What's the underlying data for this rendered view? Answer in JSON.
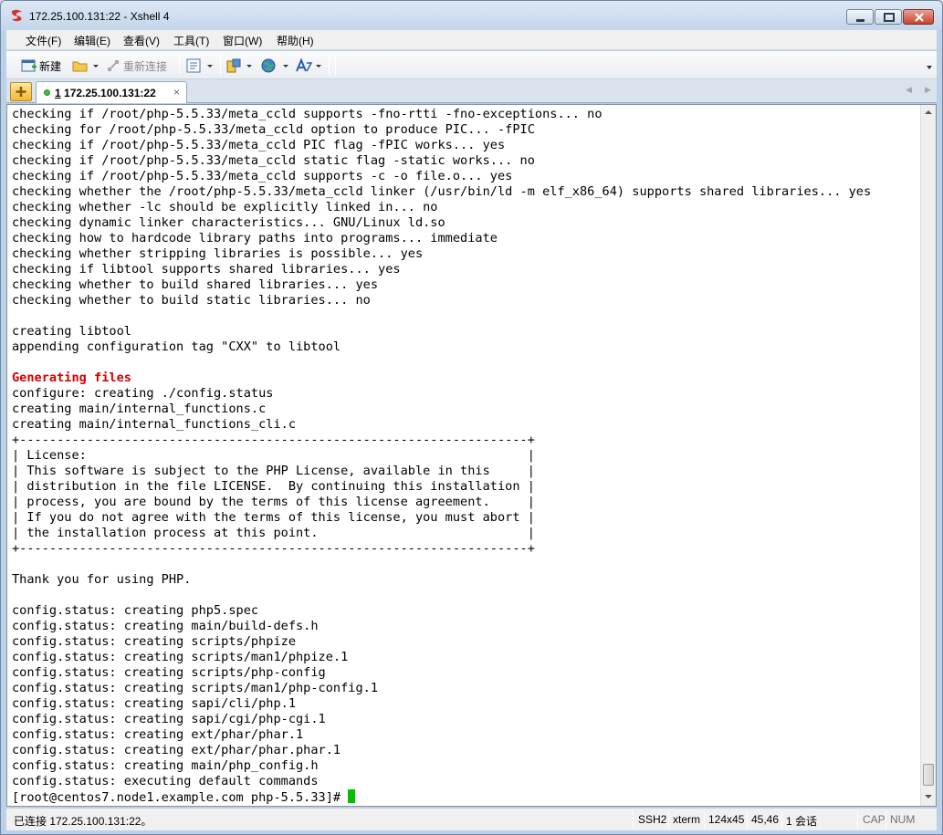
{
  "window": {
    "title": "172.25.100.131:22 - Xshell 4"
  },
  "menu": {
    "items": [
      "文件(F)",
      "编辑(E)",
      "查看(V)",
      "工具(T)",
      "窗口(W)",
      "帮助(H)"
    ]
  },
  "toolbar": {
    "new_label": "新建",
    "reconnect_label": "重新连接"
  },
  "tabs": [
    {
      "number": "1",
      "label": " 172.25.100.131:22",
      "close": "×"
    }
  ],
  "terminal": {
    "lines": [
      "checking if /root/php-5.5.33/meta_ccld supports -fno-rtti -fno-exceptions... no",
      "checking for /root/php-5.5.33/meta_ccld option to produce PIC... -fPIC",
      "checking if /root/php-5.5.33/meta_ccld PIC flag -fPIC works... yes",
      "checking if /root/php-5.5.33/meta_ccld static flag -static works... no",
      "checking if /root/php-5.5.33/meta_ccld supports -c -o file.o... yes",
      "checking whether the /root/php-5.5.33/meta_ccld linker (/usr/bin/ld -m elf_x86_64) supports shared libraries... yes",
      "checking whether -lc should be explicitly linked in... no",
      "checking dynamic linker characteristics... GNU/Linux ld.so",
      "checking how to hardcode library paths into programs... immediate",
      "checking whether stripping libraries is possible... yes",
      "checking if libtool supports shared libraries... yes",
      "checking whether to build shared libraries... yes",
      "checking whether to build static libraries... no",
      "",
      "creating libtool",
      "appending configuration tag \"CXX\" to libtool",
      "",
      "Generating files",
      "configure: creating ./config.status",
      "creating main/internal_functions.c",
      "creating main/internal_functions_cli.c",
      "+--------------------------------------------------------------------+",
      "| License:                                                           |",
      "| This software is subject to the PHP License, available in this     |",
      "| distribution in the file LICENSE.  By continuing this installation |",
      "| process, you are bound by the terms of this license agreement.     |",
      "| If you do not agree with the terms of this license, you must abort |",
      "| the installation process at this point.                            |",
      "+--------------------------------------------------------------------+",
      "",
      "Thank you for using PHP.",
      "",
      "config.status: creating php5.spec",
      "config.status: creating main/build-defs.h",
      "config.status: creating scripts/phpize",
      "config.status: creating scripts/man1/phpize.1",
      "config.status: creating scripts/php-config",
      "config.status: creating scripts/man1/php-config.1",
      "config.status: creating sapi/cli/php.1",
      "config.status: creating sapi/cgi/php-cgi.1",
      "config.status: creating ext/phar/phar.1",
      "config.status: creating ext/phar/phar.phar.1",
      "config.status: creating main/php_config.h",
      "config.status: executing default commands"
    ],
    "highlight_line": "Generating files",
    "prompt": "[root@centos7.node1.example.com php-5.5.33]# "
  },
  "status": {
    "connection": "已连接 172.25.100.131:22。",
    "protocol": "SSH2",
    "term": "xterm",
    "size": "124x45",
    "cursor_pos": "45,46",
    "sessions": "1 会话",
    "cap": "CAP",
    "num": "NUM"
  }
}
